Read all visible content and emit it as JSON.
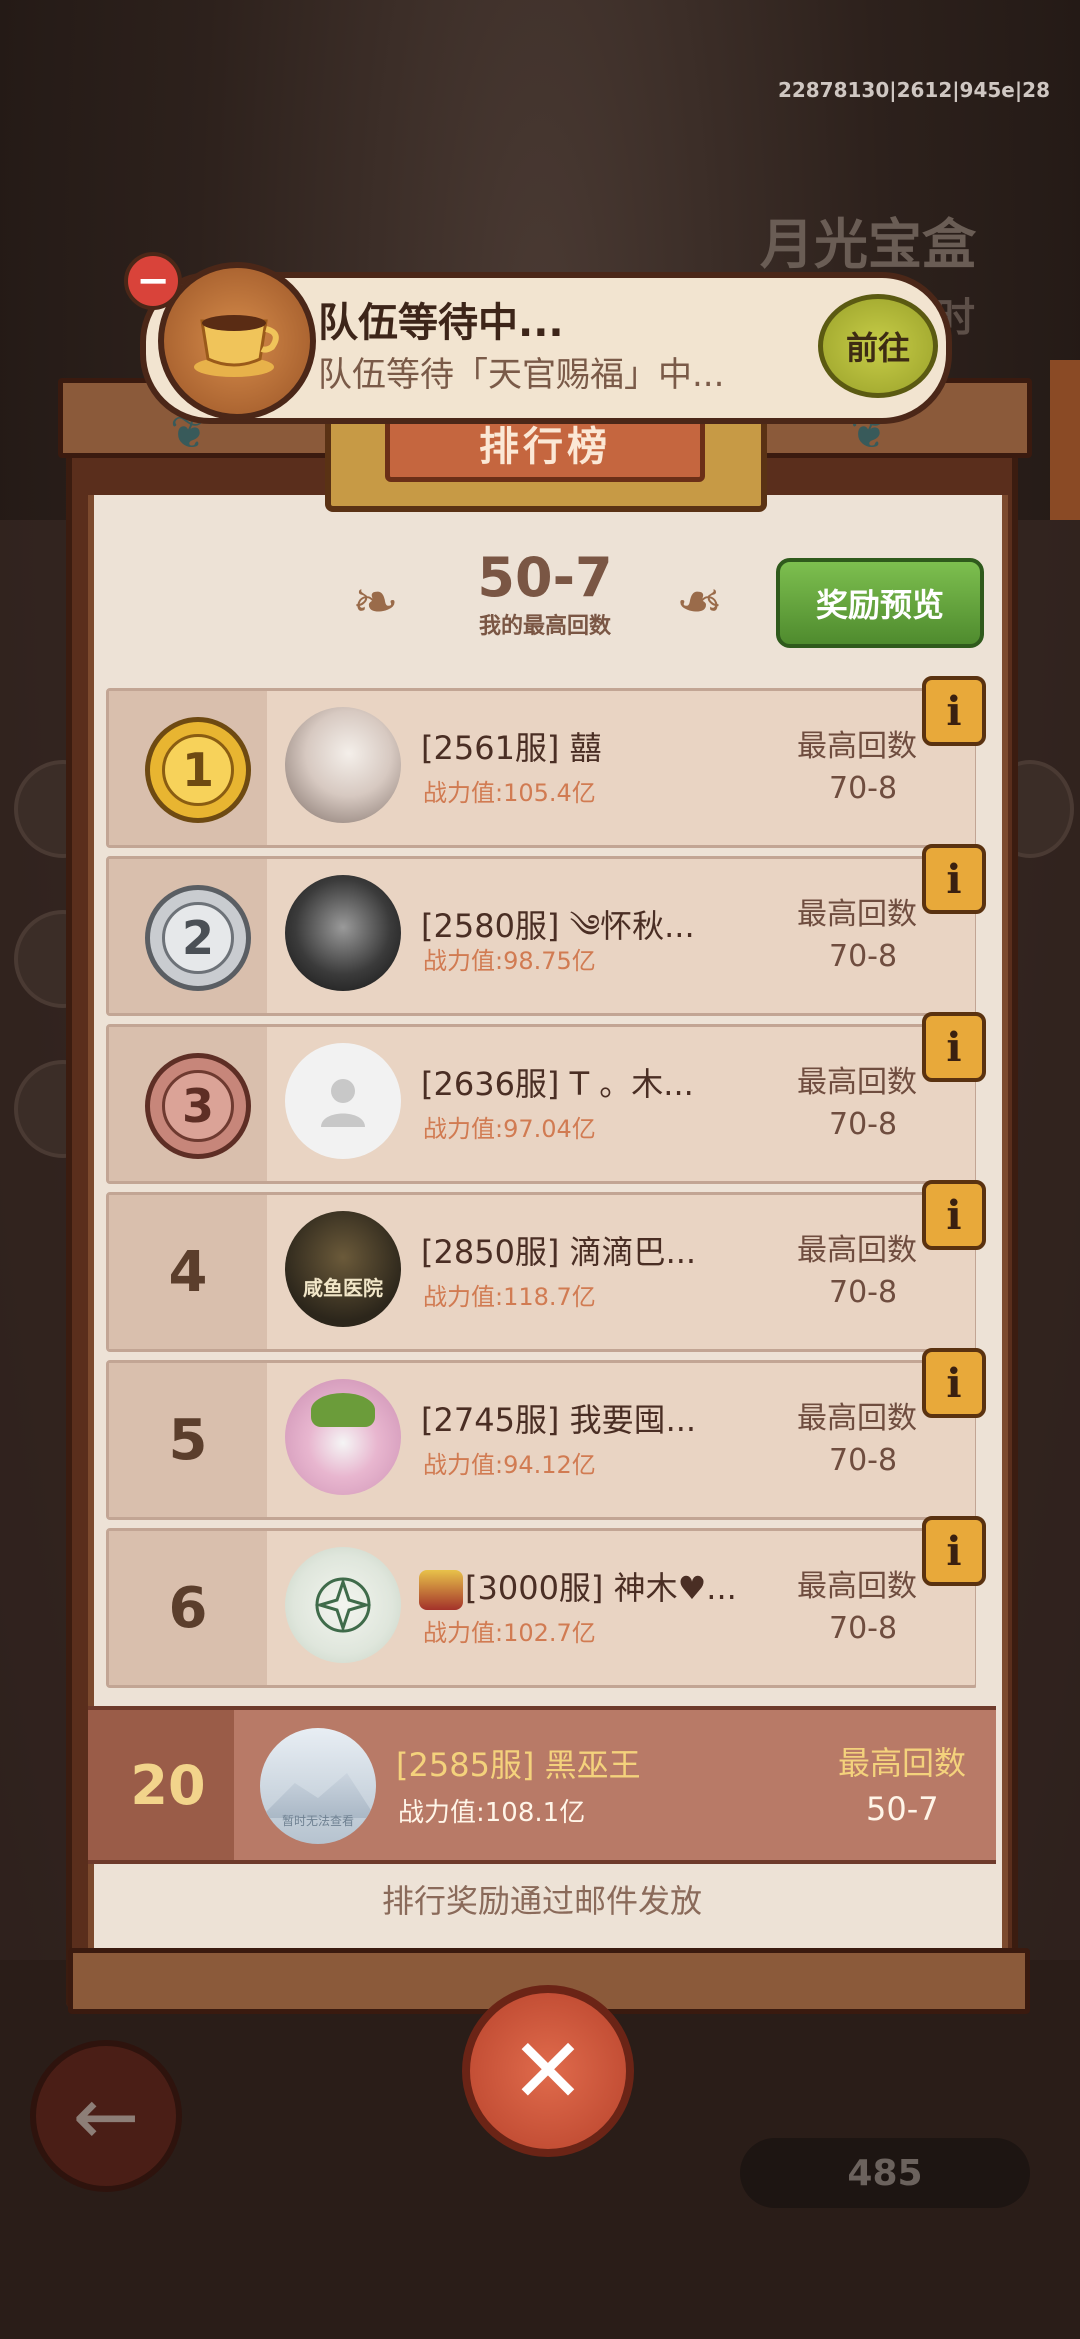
{
  "debug_id": "22878130|2612|945e|28",
  "background": {
    "event_title": "月光宝盒",
    "event_sub": "小时",
    "counter": "485"
  },
  "notification": {
    "title": "队伍等待中...",
    "subtitle": "队伍等待「天官赐福」中...",
    "go_label": "前往"
  },
  "board": {
    "title": "排行榜",
    "my_best_value": "50-7",
    "my_best_label": "我的最高回数",
    "reward_preview_label": "奖励预览",
    "footer_text": "排行奖励通过邮件发放"
  },
  "rows": [
    {
      "rank": "1",
      "name": "[2561服] 囍",
      "power": "战力值:105.4亿",
      "high_label": "最高回数",
      "high_value": "70-8"
    },
    {
      "rank": "2",
      "name": "[2580服] ༄怀秋...",
      "power": "战力值:98.75亿",
      "high_label": "最高回数",
      "high_value": "70-8"
    },
    {
      "rank": "3",
      "name": "[2636服] T 。木...",
      "power": "战力值:97.04亿",
      "high_label": "最高回数",
      "high_value": "70-8"
    },
    {
      "rank": "4",
      "name": "[2850服] 滴滴巴...",
      "power": "战力值:118.7亿",
      "high_label": "最高回数",
      "high_value": "70-8",
      "avatar_text": "咸鱼医院"
    },
    {
      "rank": "5",
      "name": "[2745服] 我要囤...",
      "power": "战力值:94.12亿",
      "high_label": "最高回数",
      "high_value": "70-8"
    },
    {
      "rank": "6",
      "name": "[3000服] 神木♥...",
      "power": "战力值:102.7亿",
      "high_label": "最高回数",
      "high_value": "70-8"
    }
  ],
  "my_row": {
    "rank": "20",
    "name": "[2585服] 黑巫王",
    "power": "战力值:108.1亿",
    "high_label": "最高回数",
    "high_value": "50-7",
    "avatar_text": "暂时无法查看"
  },
  "colors": {
    "gold_medal": "#e8b531",
    "silver_medal": "#c9ccd0",
    "bronze_medal": "#c7867a",
    "green_button": "#5fa23a",
    "close_red": "#c9503a"
  }
}
